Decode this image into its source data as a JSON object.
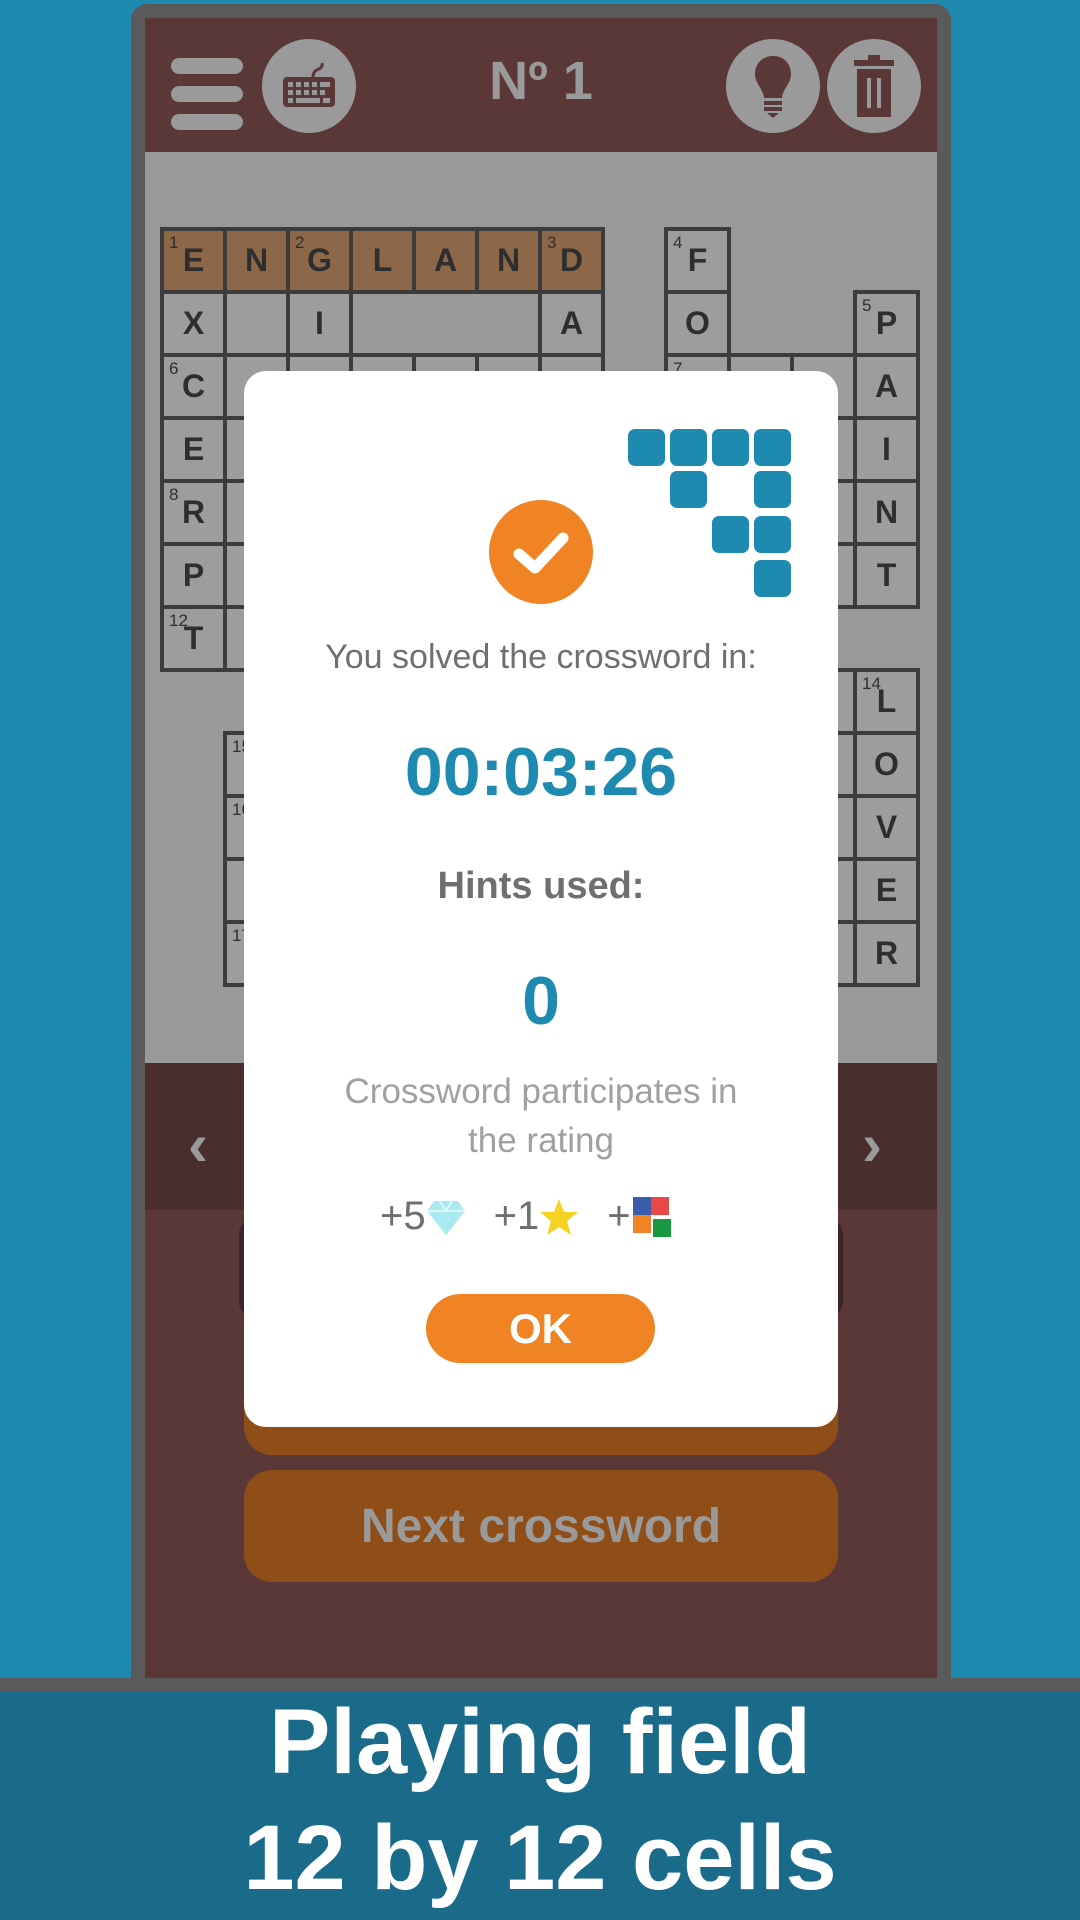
{
  "header": {
    "title": "Nº 1",
    "icons": [
      "hamburger-menu-icon",
      "keyboard-icon",
      "lightbulb-hint-icon",
      "trash-icon"
    ]
  },
  "grid": {
    "size": "12x12",
    "cells": [
      {
        "r": 0,
        "c": 0,
        "l": "E",
        "n": "1",
        "hl": true
      },
      {
        "r": 0,
        "c": 1,
        "l": "N",
        "hl": true
      },
      {
        "r": 0,
        "c": 2,
        "l": "G",
        "n": "2",
        "hl": true
      },
      {
        "r": 0,
        "c": 3,
        "l": "L",
        "hl": true
      },
      {
        "r": 0,
        "c": 4,
        "l": "A",
        "hl": true
      },
      {
        "r": 0,
        "c": 5,
        "l": "N",
        "hl": true
      },
      {
        "r": 0,
        "c": 6,
        "l": "D",
        "n": "3",
        "hl": true
      },
      {
        "r": 0,
        "c": 8,
        "l": "F",
        "n": "4"
      },
      {
        "r": 1,
        "c": 0,
        "l": "X"
      },
      {
        "r": 1,
        "c": 1,
        "l": ""
      },
      {
        "r": 1,
        "c": 2,
        "l": "I"
      },
      {
        "r": 1,
        "c": 6,
        "l": "A"
      },
      {
        "r": 1,
        "c": 8,
        "l": "O"
      },
      {
        "r": 1,
        "c": 11,
        "l": "P",
        "n": "5"
      },
      {
        "r": 2,
        "c": 0,
        "l": "C",
        "n": "6"
      },
      {
        "r": 2,
        "c": 1,
        "l": ""
      },
      {
        "r": 2,
        "c": 2,
        "l": ""
      },
      {
        "r": 2,
        "c": 3,
        "l": ""
      },
      {
        "r": 2,
        "c": 4,
        "l": ""
      },
      {
        "r": 2,
        "c": 5,
        "l": ""
      },
      {
        "r": 2,
        "c": 6,
        "l": ""
      },
      {
        "r": 2,
        "c": 8,
        "l": "",
        "n": "7"
      },
      {
        "r": 2,
        "c": 9,
        "l": ""
      },
      {
        "r": 2,
        "c": 10,
        "l": ""
      },
      {
        "r": 2,
        "c": 11,
        "l": "A"
      },
      {
        "r": 3,
        "c": 0,
        "l": "E"
      },
      {
        "r": 3,
        "c": 1,
        "l": ""
      },
      {
        "r": 3,
        "c": 10,
        "l": ""
      },
      {
        "r": 3,
        "c": 11,
        "l": "I"
      },
      {
        "r": 4,
        "c": 0,
        "l": "R",
        "n": "8"
      },
      {
        "r": 4,
        "c": 1,
        "l": ""
      },
      {
        "r": 4,
        "c": 10,
        "l": ""
      },
      {
        "r": 4,
        "c": 11,
        "l": "N"
      },
      {
        "r": 5,
        "c": 0,
        "l": "P"
      },
      {
        "r": 5,
        "c": 1,
        "l": ""
      },
      {
        "r": 5,
        "c": 10,
        "l": ""
      },
      {
        "r": 5,
        "c": 11,
        "l": "T"
      },
      {
        "r": 6,
        "c": 0,
        "l": "T",
        "n": "12"
      },
      {
        "r": 6,
        "c": 1,
        "l": ""
      },
      {
        "r": 7,
        "c": 10,
        "l": ""
      },
      {
        "r": 7,
        "c": 11,
        "l": "L",
        "n": "14"
      },
      {
        "r": 8,
        "c": 1,
        "l": "",
        "n": "15"
      },
      {
        "r": 8,
        "c": 10,
        "l": ""
      },
      {
        "r": 8,
        "c": 11,
        "l": "O"
      },
      {
        "r": 9,
        "c": 1,
        "l": "",
        "n": "16"
      },
      {
        "r": 9,
        "c": 10,
        "l": ""
      },
      {
        "r": 9,
        "c": 11,
        "l": "V"
      },
      {
        "r": 10,
        "c": 1,
        "l": ""
      },
      {
        "r": 10,
        "c": 10,
        "l": ""
      },
      {
        "r": 10,
        "c": 11,
        "l": "E"
      },
      {
        "r": 11,
        "c": 1,
        "l": "",
        "n": "17"
      },
      {
        "r": 11,
        "c": 10,
        "l": ""
      },
      {
        "r": 11,
        "c": 11,
        "l": "R"
      }
    ]
  },
  "nav": {
    "prev": "‹",
    "next": "›"
  },
  "next_button": "Next crossword",
  "modal": {
    "solved_label": "You solved the crossword in:",
    "time": "00:03:26",
    "hints_label": "Hints used:",
    "hints_value": "0",
    "rating_line1": "Crossword participates in",
    "rating_line2": "the rating",
    "rewards": [
      {
        "amount": "+5",
        "icon": "diamond-icon"
      },
      {
        "amount": "+1",
        "icon": "star-icon"
      },
      {
        "amount": "+",
        "icon": "puzzle-icon"
      }
    ],
    "ok_label": "OK"
  },
  "banner": {
    "line1": "Playing field",
    "line2": "12 by 12 cells"
  },
  "colors": {
    "background": "#1f8ab0",
    "accent_orange": "#f08323",
    "accent_blue": "#1f8ab0",
    "app_brown": "#5a3838"
  }
}
